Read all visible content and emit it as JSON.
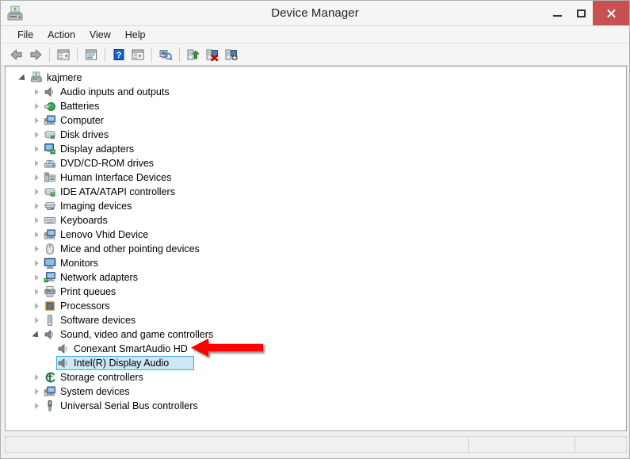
{
  "window": {
    "title": "Device Manager",
    "app_icon": "device-manager-icon",
    "controls": {
      "minimize": "Minimize",
      "maximize": "Maximize",
      "close": "Close",
      "close_color": "#c75050"
    }
  },
  "menubar": {
    "items": [
      {
        "label": "File",
        "name": "menu-file"
      },
      {
        "label": "Action",
        "name": "menu-action"
      },
      {
        "label": "View",
        "name": "menu-view"
      },
      {
        "label": "Help",
        "name": "menu-help"
      }
    ]
  },
  "toolbar": {
    "buttons": [
      {
        "icon": "back-arrow-icon",
        "tooltip": "Back"
      },
      {
        "icon": "forward-arrow-icon",
        "tooltip": "Forward"
      },
      {
        "sep": true
      },
      {
        "icon": "show-hide-console-tree-icon",
        "tooltip": "Show/Hide Console Tree"
      },
      {
        "sep": true
      },
      {
        "icon": "properties-icon",
        "tooltip": "Properties"
      },
      {
        "sep": true
      },
      {
        "icon": "help-icon",
        "tooltip": "Help"
      },
      {
        "icon": "show-hide-action-pane-icon",
        "tooltip": "Show/Hide Action Pane"
      },
      {
        "sep": true
      },
      {
        "icon": "scan-for-hardware-changes-icon",
        "tooltip": "Scan for hardware changes"
      },
      {
        "sep": true
      },
      {
        "icon": "update-driver-icon",
        "tooltip": "Update Driver Software"
      },
      {
        "icon": "disable-device-icon",
        "tooltip": "Disable"
      },
      {
        "icon": "uninstall-device-icon",
        "tooltip": "Uninstall"
      }
    ]
  },
  "tree": {
    "root": {
      "label": "kajmere",
      "icon": "computer-root-icon",
      "expanded": true,
      "name": "tree-node-kajmere"
    },
    "nodes": [
      {
        "label": "Audio inputs and outputs",
        "icon": "speaker-icon",
        "expanded": false,
        "level": 1,
        "name": "tree-node-audio-inputs-and-outputs"
      },
      {
        "label": "Batteries",
        "icon": "battery-icon",
        "expanded": false,
        "level": 1,
        "name": "tree-node-batteries"
      },
      {
        "label": "Computer",
        "icon": "computer-icon",
        "expanded": false,
        "level": 1,
        "name": "tree-node-computer"
      },
      {
        "label": "Disk drives",
        "icon": "disk-drive-icon",
        "expanded": false,
        "level": 1,
        "name": "tree-node-disk-drives"
      },
      {
        "label": "Display adapters",
        "icon": "display-adapter-icon",
        "expanded": false,
        "level": 1,
        "name": "tree-node-display-adapters"
      },
      {
        "label": "DVD/CD-ROM drives",
        "icon": "dvd-drive-icon",
        "expanded": false,
        "level": 1,
        "name": "tree-node-dvd-cd-rom-drives"
      },
      {
        "label": "Human Interface Devices",
        "icon": "hid-icon",
        "expanded": false,
        "level": 1,
        "name": "tree-node-human-interface-devices"
      },
      {
        "label": "IDE ATA/ATAPI controllers",
        "icon": "ide-controller-icon",
        "expanded": false,
        "level": 1,
        "name": "tree-node-ide-ata-atapi-controllers"
      },
      {
        "label": "Imaging devices",
        "icon": "imaging-device-icon",
        "expanded": false,
        "level": 1,
        "name": "tree-node-imaging-devices"
      },
      {
        "label": "Keyboards",
        "icon": "keyboard-icon",
        "expanded": false,
        "level": 1,
        "name": "tree-node-keyboards"
      },
      {
        "label": "Lenovo Vhid Device",
        "icon": "system-device-icon",
        "expanded": false,
        "level": 1,
        "name": "tree-node-lenovo-vhid-device"
      },
      {
        "label": "Mice and other pointing devices",
        "icon": "mouse-icon",
        "expanded": false,
        "level": 1,
        "name": "tree-node-mice-and-other-pointing-devices"
      },
      {
        "label": "Monitors",
        "icon": "monitor-icon",
        "expanded": false,
        "level": 1,
        "name": "tree-node-monitors"
      },
      {
        "label": "Network adapters",
        "icon": "network-adapter-icon",
        "expanded": false,
        "level": 1,
        "name": "tree-node-network-adapters"
      },
      {
        "label": "Print queues",
        "icon": "printer-icon",
        "expanded": false,
        "level": 1,
        "name": "tree-node-print-queues"
      },
      {
        "label": "Processors",
        "icon": "processor-icon",
        "expanded": false,
        "level": 1,
        "name": "tree-node-processors"
      },
      {
        "label": "Software devices",
        "icon": "software-device-icon",
        "expanded": false,
        "level": 1,
        "name": "tree-node-software-devices"
      },
      {
        "label": "Sound, video and game controllers",
        "icon": "speaker-icon",
        "expanded": true,
        "level": 1,
        "name": "tree-node-sound-video-and-game-controllers"
      },
      {
        "label": "Conexant SmartAudio HD",
        "icon": "speaker-icon",
        "leaf": true,
        "level": 2,
        "name": "tree-node-conexant-smartaudio-hd"
      },
      {
        "label": "Intel(R) Display Audio",
        "icon": "speaker-icon",
        "leaf": true,
        "level": 2,
        "selected": true,
        "name": "tree-node-intel-display-audio"
      },
      {
        "label": "Storage controllers",
        "icon": "storage-controller-icon",
        "expanded": false,
        "level": 1,
        "name": "tree-node-storage-controllers"
      },
      {
        "label": "System devices",
        "icon": "system-device-icon",
        "expanded": false,
        "level": 1,
        "name": "tree-node-system-devices"
      },
      {
        "label": "Universal Serial Bus controllers",
        "icon": "usb-icon",
        "expanded": false,
        "level": 1,
        "name": "tree-node-universal-serial-bus-controllers"
      }
    ],
    "selection_fill": "#cce8f7",
    "selection_border": "#42a5dd"
  },
  "annotation": {
    "type": "arrow",
    "direction": "left",
    "color": "#ff0000",
    "points_at": "Conexant SmartAudio HD",
    "name": "red-arrow-annotation"
  },
  "statusbar": {
    "panes": [
      "",
      "",
      ""
    ]
  }
}
